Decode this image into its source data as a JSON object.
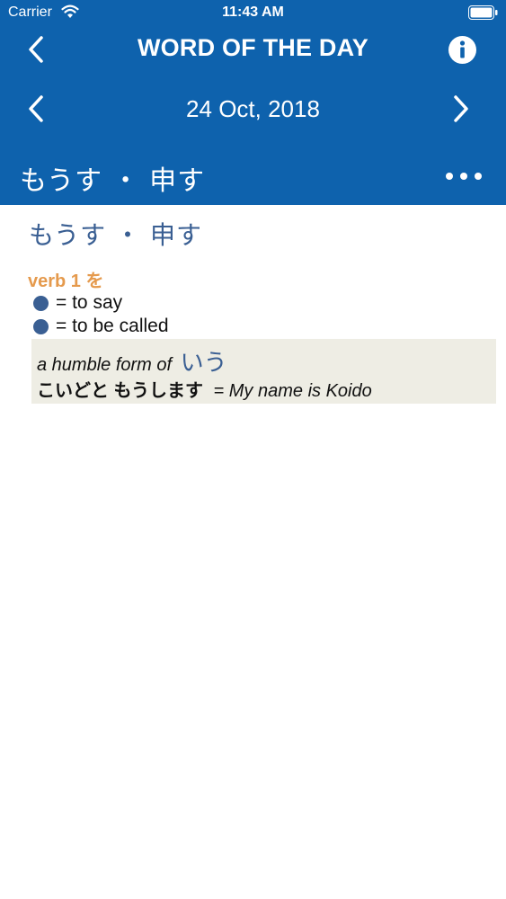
{
  "status_bar": {
    "carrier": "Carrier",
    "time": "11:43 AM",
    "icons": [
      "wifi-icon",
      "battery-icon"
    ]
  },
  "nav": {
    "title": "WORD OF THE DAY",
    "back_icon": "chevron-left-icon",
    "info_icon": "info-icon"
  },
  "date_nav": {
    "date": "24 Oct, 2018",
    "prev_icon": "chevron-left-icon",
    "next_icon": "chevron-right-icon"
  },
  "word_bar": {
    "word": "もうす ・ 申す",
    "more_icon": "more-dots-icon"
  },
  "entry": {
    "heading": "もうす ・ 申す",
    "part_of_speech": "verb 1 を",
    "meanings": [
      "= to say",
      "= to be called"
    ],
    "note": {
      "description": "a humble form of",
      "reference": "いう",
      "example_jp": "こいどと もうします",
      "example_en": "= My name is Koido"
    }
  },
  "colors": {
    "header_bg": "#0e62ad",
    "accent_blue": "#3a5f93",
    "pos_orange": "#e59a4d",
    "note_bg": "#eeede4"
  }
}
